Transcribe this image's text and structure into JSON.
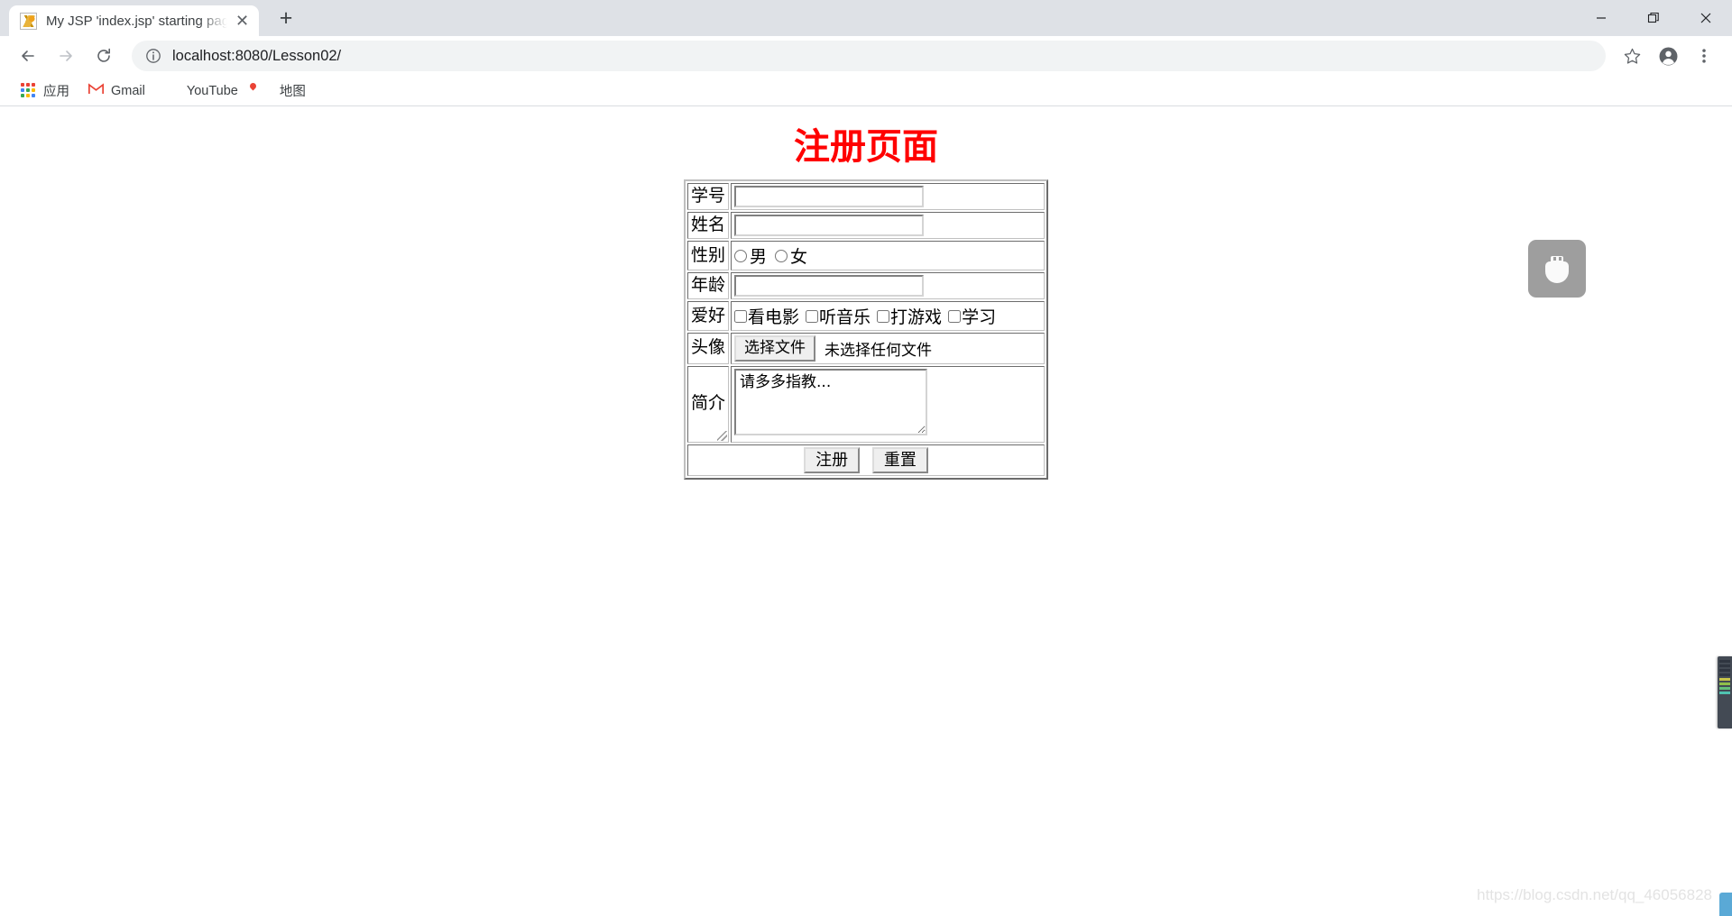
{
  "browser": {
    "tab": {
      "title": "My JSP 'index.jsp' starting page",
      "favicon_name": "tomcat-favicon",
      "close_label": "✕"
    },
    "newtab_label": "+",
    "window_controls": {
      "minimize": "minimize",
      "maximize": "maximize",
      "close": "close"
    },
    "toolbar": {
      "back_label": "back",
      "forward_label": "forward",
      "reload_label": "reload",
      "url": "localhost:8080/Lesson02/",
      "info_icon": "site-information-icon",
      "bookmark_star": "bookmark-star-icon",
      "profile": "profile-avatar-icon",
      "menu": "three-dot-menu-icon"
    },
    "bookmarks": [
      {
        "label": "应用",
        "icon": "apps-grid-icon"
      },
      {
        "label": "Gmail",
        "icon": "gmail-icon"
      },
      {
        "label": "YouTube",
        "icon": "youtube-icon"
      },
      {
        "label": "地图",
        "icon": "maps-icon"
      }
    ]
  },
  "page": {
    "title": "注册页面",
    "title_color": "#ff0000",
    "broken_image_icon": "broken-image-placeholder-icon",
    "form": {
      "rows": [
        {
          "label": "学号",
          "type": "text",
          "value": ""
        },
        {
          "label": "姓名",
          "type": "text",
          "value": ""
        },
        {
          "label": "性别",
          "type": "radio",
          "options": [
            "男",
            "女"
          ]
        },
        {
          "label": "年龄",
          "type": "text",
          "value": ""
        },
        {
          "label": "爱好",
          "type": "checkbox",
          "options": [
            "看电影",
            "听音乐",
            "打游戏",
            "学习"
          ]
        },
        {
          "label": "头像",
          "type": "file",
          "button": "选择文件",
          "status": "未选择任何文件"
        },
        {
          "label": "简介",
          "type": "textarea",
          "value": "请多多指教..."
        }
      ],
      "submit_label": "注册",
      "reset_label": "重置"
    },
    "watermark": "https://blog.csdn.net/qq_46056828"
  }
}
